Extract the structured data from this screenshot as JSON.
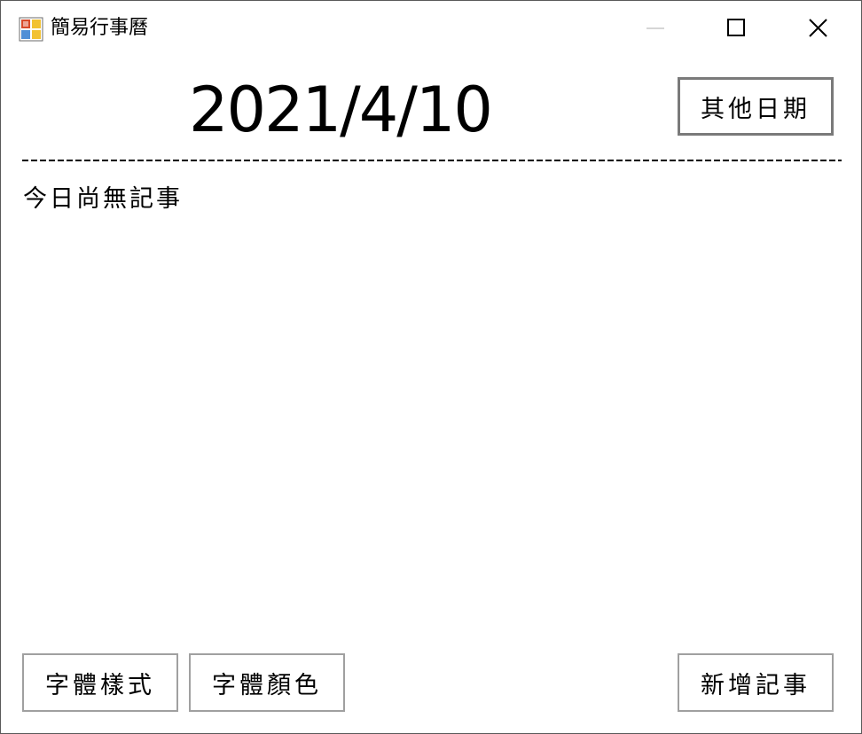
{
  "window": {
    "title": "簡易行事曆",
    "icon": "app-icon"
  },
  "header": {
    "date": "2021/4/10",
    "other_date_label": "其他日期"
  },
  "notes": {
    "empty_text": "今日尚無記事"
  },
  "footer": {
    "font_style_label": "字體樣式",
    "font_color_label": "字體顏色",
    "add_note_label": "新增記事"
  },
  "colors": {
    "background": "#ffffff",
    "button_border": "#a0a0a0",
    "focused_border": "#7a7a7a",
    "separator": "#000000"
  }
}
